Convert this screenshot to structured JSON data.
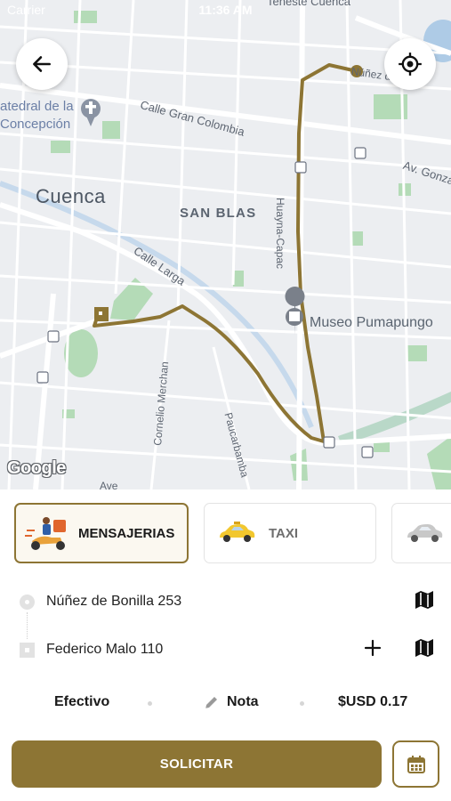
{
  "status_bar": {
    "carrier": "Carrier",
    "time": "11:36 AM"
  },
  "map": {
    "back_button_icon": "arrow-left-icon",
    "locate_button_icon": "crosshair-icon",
    "labels": {
      "top_label": "Teneste Cuenca",
      "catedral_line1": "atedral de la",
      "catedral_line2": "Concepción",
      "gran_colombia": "Calle Gran Colombia",
      "cuenca": "Cuenca",
      "san_blas": "SAN BLAS",
      "av_gonzalez": "Av. Gonzá",
      "huayna_capac": "Huayna-Capac",
      "calle_larga": "Calle Larga",
      "museo": "Museo Pumapungo",
      "cornelio": "Cornelio Merchan",
      "paucarbamba": "Paucarbamba",
      "nunez": "Núñez d",
      "ave": "Ave",
      "google": "Google"
    },
    "route_color": "#8d7534"
  },
  "services": [
    {
      "label": "MENSAJERIAS",
      "icon": "delivery-scooter-icon",
      "selected": true
    },
    {
      "label": "TAXI",
      "icon": "taxi-car-icon",
      "selected": false
    },
    {
      "label": "",
      "icon": "car-icon",
      "selected": false
    }
  ],
  "origin": {
    "address": "Núñez de Bonilla 253"
  },
  "destination": {
    "address": "Federico Malo 110"
  },
  "options": {
    "payment": "Efectivo",
    "note": "Nota",
    "price": "$USD 0.17"
  },
  "actions": {
    "request_label": "SOLICITAR",
    "schedule_icon": "calendar-icon"
  },
  "colors": {
    "accent": "#8d7534",
    "map_bg": "#eceef1",
    "park": "#b4dbb7"
  }
}
